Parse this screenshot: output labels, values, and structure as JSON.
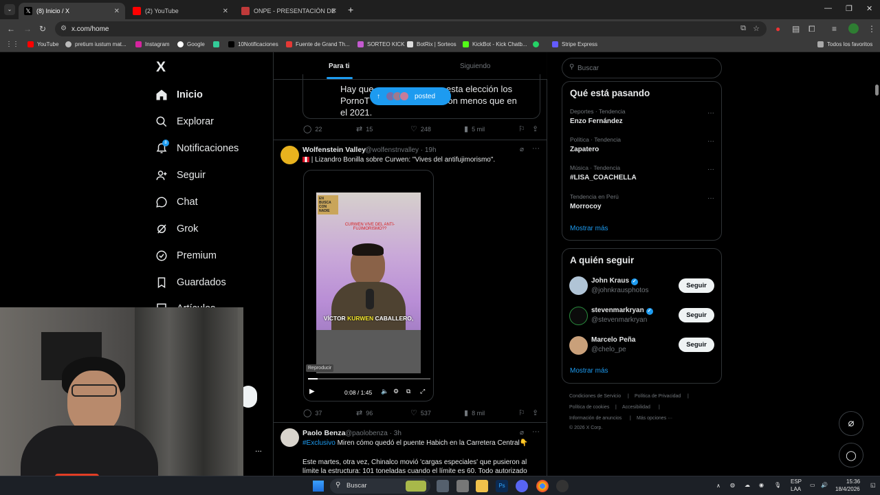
{
  "browser": {
    "tabs": [
      {
        "title": "(8) Inicio / X",
        "active": true
      },
      {
        "title": "(2) YouTube",
        "active": false
      },
      {
        "title": "ONPE - PRESENTACIÓN DE RES",
        "active": false
      }
    ],
    "new_tab": "+",
    "url": "x.com/home",
    "bookmarks": [
      "YouTube",
      "pretium iustum mat...",
      "Instagram",
      "Google",
      "10Notificaciones",
      "Fuente de Grand Th...",
      "SORTEO KICK",
      "BotRix | Sorteos",
      "KickBot - Kick Chatb...",
      "Stripe Express",
      "Todos los favoritos"
    ]
  },
  "x": {
    "logo": "X",
    "nav": [
      {
        "label": "Inicio",
        "icon": "home-icon"
      },
      {
        "label": "Explorar",
        "icon": "search-icon"
      },
      {
        "label": "Notificaciones",
        "icon": "bell-icon",
        "badge": "8"
      },
      {
        "label": "Seguir",
        "icon": "add-user-icon"
      },
      {
        "label": "Chat",
        "icon": "chat-icon"
      },
      {
        "label": "Grok",
        "icon": "grok-icon"
      },
      {
        "label": "Premium",
        "icon": "premium-icon"
      },
      {
        "label": "Guardados",
        "icon": "bookmark-icon"
      },
      {
        "label": "Artículos",
        "icon": "article-icon"
      }
    ],
    "more_dots": "...",
    "timeline_tabs": [
      "Para ti",
      "Siguiendo"
    ],
    "posted_pill": "posted",
    "tweet1": {
      "text_top": "Hay que ... esta elección los PornoT... a son menos que en el 2021.",
      "line1": "Hay que",
      "line1b": "esta elección los",
      "line2": "PornoT",
      "line2b": "a son menos que en",
      "line3": "el 2021.",
      "replies": "22",
      "reposts": "15",
      "likes": "248",
      "views": "5 mil"
    },
    "tweet2": {
      "author": "Wolfenstein Valley",
      "handle": "@wolfenstnvalley · 19h",
      "text": "| Lizandro Bonilla sobre Curwen: \"Vives del antifujimorismo\".",
      "video_caption_top": "CURWEN VIVE DEL ANTI-FUJIMORISMO??",
      "video_caption_bottom": "VÍCTOR KURWEN CABALLERO,",
      "video_caption_highlight": "KURWEN",
      "video_logo": "EN BUSCA CON NADIE",
      "tooltip": "Reproducir",
      "time": "0:08 / 1:45",
      "progress": 0.076,
      "replies": "37",
      "reposts": "96",
      "likes": "537",
      "views": "8 mil"
    },
    "tweet3": {
      "author": "Paolo Benza",
      "handle": "@paolobenza · 3h",
      "hashtag": "#Exclusivo",
      "text": "Miren cómo quedó el puente Habich en la Carretera Central👇",
      "body": "Este martes, otra vez, Chinalco movió 'cargas especiales' que pusieron al límite la estructura: 101 toneladas cuando el límite es 60. Todo autorizado"
    },
    "search_placeholder": "Buscar",
    "trends_title": "Qué está pasando",
    "trends": [
      {
        "category": "Deportes · Tendencia",
        "name": "Enzo Fernández"
      },
      {
        "category": "Política · Tendencia",
        "name": "Zapatero"
      },
      {
        "category": "Música · Tendencia",
        "name": "#LISA_COACHELLA"
      },
      {
        "category": "Tendencia en Perú",
        "name": "Morrocoy"
      }
    ],
    "show_more": "Mostrar más",
    "follow_title": "A quién seguir",
    "follow": [
      {
        "name": "John Kraus",
        "handle": "@johnkrausphotos",
        "verified": true
      },
      {
        "name": "stevenmarkryan",
        "handle": "@stevenmarkryan",
        "verified": true
      },
      {
        "name": "Marcelo Peña",
        "handle": "@chelo_pe",
        "verified": false
      }
    ],
    "follow_button": "Seguir",
    "footer": [
      "Condiciones de Servicio",
      "|",
      "Política de Privacidad",
      "|",
      "Política de cookies",
      "|",
      "Accesibilidad",
      "|",
      "Información de anuncios",
      "|",
      "Más opciones ···",
      "© 2026 X Corp."
    ]
  },
  "taskbar": {
    "search": "Buscar",
    "lang1": "ESP",
    "lang2": "LAA",
    "time": "15:36",
    "date": "18/4/2026"
  },
  "colors": {
    "accent": "#1d9bf0",
    "bg": "#000000",
    "border": "#2f3336",
    "muted": "#71767b"
  }
}
